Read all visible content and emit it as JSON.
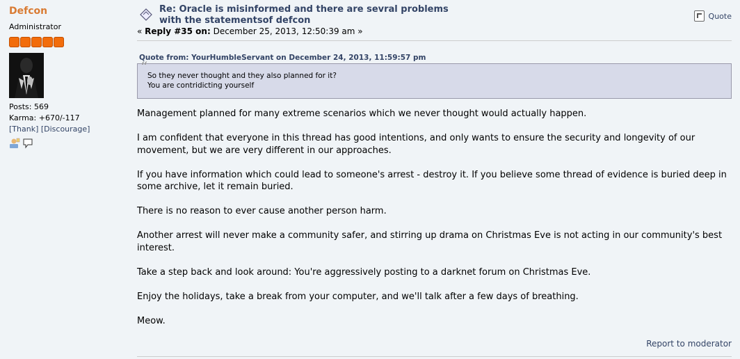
{
  "poster": {
    "name": "Defcon",
    "group": "Administrator",
    "stars": 5,
    "posts": "Posts: 569",
    "karma": "Karma: +670/-117",
    "thank": "[Thank]",
    "discourage": "[Discourage]",
    "icons": [
      "profile-icon",
      "personal-message-icon"
    ]
  },
  "post": {
    "subject_line1": "Re: Oracle is misinformed and there are sevral problems",
    "subject_line2": "with the statementsof defcon",
    "reply_prefix": "« ",
    "reply_label": "Reply #35 on:",
    "reply_date": " December 25, 2013, 12:50:39 am »",
    "quote_button": "Quote",
    "quote": {
      "header": "Quote from: YourHumbleServant on December 24, 2013, 11:59:57 pm",
      "line1": "So they never thought and they also planned for it?",
      "line2": "You are contridicting yourself"
    },
    "paragraphs": [
      "Management planned for many extreme scenarios which we never thought would actually happen.",
      "I am confident that everyone in this thread has good intentions, and only wants to ensure the security and longevity of our movement, but we are very different in our approaches.",
      "If you have information which could lead to someone's arrest - destroy it. If you believe some thread of evidence is buried deep in some archive, let it remain buried.",
      "There is no reason to ever cause another person harm.",
      "Another arrest will never make a community safer, and stirring up drama on Christmas Eve is not acting in our community's best interest.",
      "Take a step back and look around: You're aggressively posting to a darknet forum on Christmas Eve.",
      "Enjoy the holidays, take a break from your computer, and we'll talk after a few days of breathing.",
      "Meow."
    ],
    "report": "Report to moderator"
  },
  "colors": {
    "background": "#f0f4f7",
    "poster_name": "#d97b33",
    "link": "#334466",
    "star": "#f26d0c",
    "quote_bg": "#d7dae9"
  }
}
